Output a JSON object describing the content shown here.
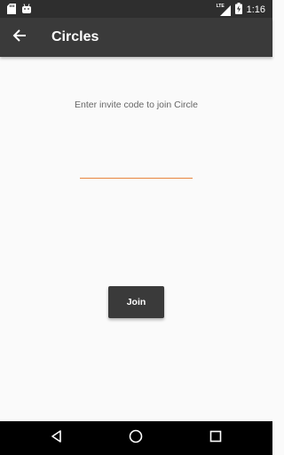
{
  "status_bar": {
    "time": "1:16",
    "network_label": "LTE",
    "icons": [
      "sd-card-icon",
      "android-icon",
      "lte-signal-icon",
      "battery-charging-icon"
    ]
  },
  "app_bar": {
    "title": "Circles",
    "back_icon": "back-arrow-icon"
  },
  "main": {
    "prompt": "Enter invite code to join Circle",
    "invite_code_value": "",
    "join_label": "Join"
  },
  "nav_bar": {
    "icons": [
      "back-triangle-icon",
      "home-circle-icon",
      "recents-square-icon"
    ]
  },
  "colors": {
    "status_bar": "#2e2e2e",
    "app_bar": "#3a3a3a",
    "background": "#fafafa",
    "accent_underline": "#e8863f",
    "button": "#3a3a3a",
    "nav_bar": "#000000"
  }
}
